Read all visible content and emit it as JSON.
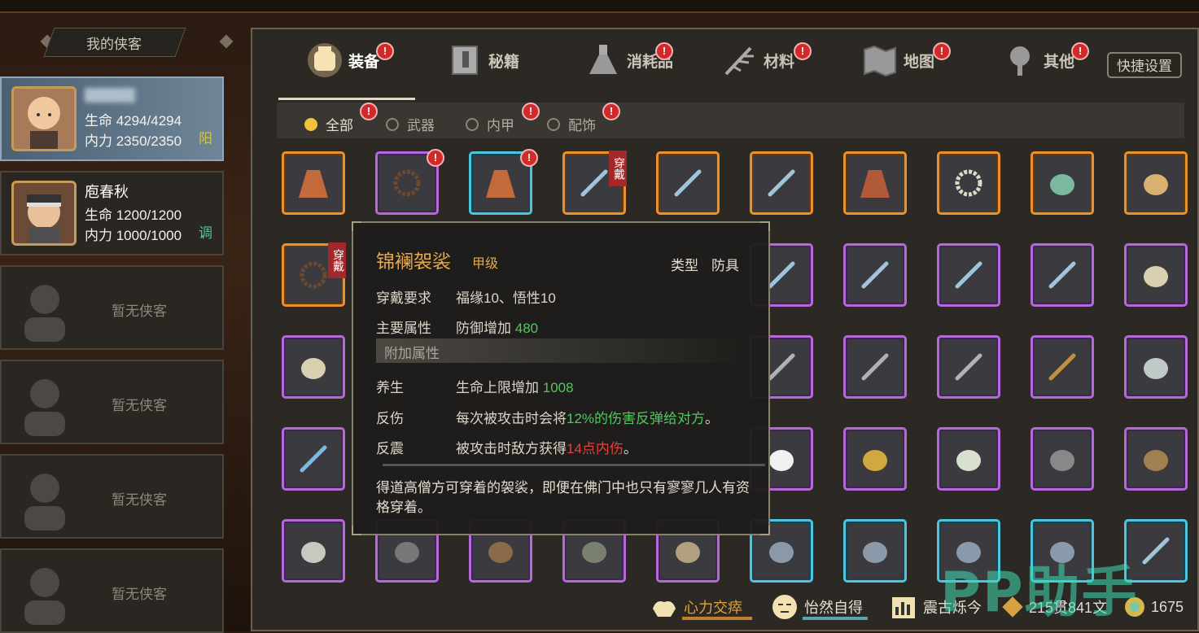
{
  "roster": {
    "header": "我的侠客",
    "members": [
      {
        "name": "",
        "hp": "生命 4294/4294",
        "mp": "内力 2350/2350",
        "tag": "阳",
        "tag_color": "#d6c33a"
      },
      {
        "name": "庖春秋",
        "hp": "生命 1200/1200",
        "mp": "内力 1000/1000",
        "tag": "调",
        "tag_color": "#4ec89a"
      }
    ],
    "empty_label": "暂无侠客"
  },
  "tabs": [
    {
      "label": "装备",
      "icon": "equipment-bag-icon",
      "alert": true
    },
    {
      "label": "秘籍",
      "icon": "book-icon",
      "alert": false
    },
    {
      "label": "消耗品",
      "icon": "potion-flask-icon",
      "alert": true
    },
    {
      "label": "材料",
      "icon": "herb-material-icon",
      "alert": true
    },
    {
      "label": "地图",
      "icon": "map-icon",
      "alert": true
    },
    {
      "label": "其他",
      "icon": "other-bag-icon",
      "alert": true
    }
  ],
  "quick_settings": "快捷设置",
  "alert_mark": "!",
  "filters": [
    {
      "label": "全部",
      "on": true,
      "alert": true
    },
    {
      "label": "武器",
      "on": false,
      "alert": false
    },
    {
      "label": "内甲",
      "on": false,
      "alert": true
    },
    {
      "label": "配饰",
      "on": false,
      "alert": true
    }
  ],
  "worn_badge": "穿戴",
  "items": [
    {
      "r": 0,
      "c": 0,
      "rarity": "o",
      "icon": "robe-icon",
      "worn": false,
      "alert": false
    },
    {
      "r": 0,
      "c": 1,
      "rarity": "p",
      "icon": "prayer-beads-icon",
      "worn": false,
      "alert": true
    },
    {
      "r": 0,
      "c": 2,
      "rarity": "c",
      "icon": "robe-icon",
      "worn": false,
      "alert": true
    },
    {
      "r": 0,
      "c": 3,
      "rarity": "o",
      "icon": "sword-icon",
      "worn": true,
      "alert": false
    },
    {
      "r": 0,
      "c": 4,
      "rarity": "o",
      "icon": "sword-icon",
      "worn": false,
      "alert": false
    },
    {
      "r": 0,
      "c": 5,
      "rarity": "o",
      "icon": "sword-icon",
      "worn": false,
      "alert": false
    },
    {
      "r": 0,
      "c": 6,
      "rarity": "o",
      "icon": "cloak-icon",
      "worn": false,
      "alert": false
    },
    {
      "r": 0,
      "c": 7,
      "rarity": "o",
      "icon": "jade-pendant-icon",
      "worn": false,
      "alert": false
    },
    {
      "r": 0,
      "c": 8,
      "rarity": "o",
      "icon": "jade-toad-icon",
      "worn": false,
      "alert": false
    },
    {
      "r": 0,
      "c": 9,
      "rarity": "o",
      "icon": "pearl-box-icon",
      "worn": false,
      "alert": false
    },
    {
      "r": 1,
      "c": 0,
      "rarity": "o",
      "icon": "prayer-beads-icon",
      "worn": true,
      "alert": false
    },
    {
      "r": 1,
      "c": 5,
      "rarity": "p",
      "icon": "sword-icon",
      "worn": false,
      "alert": false
    },
    {
      "r": 1,
      "c": 6,
      "rarity": "p",
      "icon": "sword-icon",
      "worn": false,
      "alert": false
    },
    {
      "r": 1,
      "c": 7,
      "rarity": "p",
      "icon": "sword-icon",
      "worn": false,
      "alert": false
    },
    {
      "r": 1,
      "c": 8,
      "rarity": "p",
      "icon": "sword-icon",
      "worn": false,
      "alert": false
    },
    {
      "r": 1,
      "c": 9,
      "rarity": "p",
      "icon": "scimitar-icon",
      "worn": false,
      "alert": false
    },
    {
      "r": 2,
      "c": 0,
      "rarity": "p",
      "icon": "scimitar-icon",
      "worn": false,
      "alert": false
    },
    {
      "r": 2,
      "c": 5,
      "rarity": "p",
      "icon": "spear-icon",
      "worn": false,
      "alert": false
    },
    {
      "r": 2,
      "c": 6,
      "rarity": "p",
      "icon": "spear-icon",
      "worn": false,
      "alert": false
    },
    {
      "r": 2,
      "c": 7,
      "rarity": "p",
      "icon": "spear-icon",
      "worn": false,
      "alert": false
    },
    {
      "r": 2,
      "c": 8,
      "rarity": "p",
      "icon": "staff-icon",
      "worn": false,
      "alert": false
    },
    {
      "r": 2,
      "c": 9,
      "rarity": "p",
      "icon": "fan-icon",
      "worn": false,
      "alert": false
    },
    {
      "r": 3,
      "c": 0,
      "rarity": "p",
      "icon": "double-spear-icon",
      "worn": false,
      "alert": false
    },
    {
      "r": 3,
      "c": 5,
      "rarity": "p",
      "icon": "flower-icon",
      "worn": false,
      "alert": false
    },
    {
      "r": 3,
      "c": 6,
      "rarity": "p",
      "icon": "gold-nugget-icon",
      "worn": false,
      "alert": false
    },
    {
      "r": 3,
      "c": 7,
      "rarity": "p",
      "icon": "orb-icon",
      "worn": false,
      "alert": false
    },
    {
      "r": 3,
      "c": 8,
      "rarity": "p",
      "icon": "sickle-icon",
      "worn": false,
      "alert": false
    },
    {
      "r": 3,
      "c": 9,
      "rarity": "p",
      "icon": "armor-plate-icon",
      "worn": false,
      "alert": false
    },
    {
      "r": 4,
      "c": 0,
      "rarity": "p",
      "icon": "stone-icon",
      "worn": false,
      "alert": false
    },
    {
      "r": 4,
      "c": 1,
      "rarity": "p",
      "icon": "bowl-icon",
      "worn": false,
      "alert": false
    },
    {
      "r": 4,
      "c": 2,
      "rarity": "p",
      "icon": "jar-icon",
      "worn": false,
      "alert": false
    },
    {
      "r": 4,
      "c": 3,
      "rarity": "p",
      "icon": "bar-icon",
      "worn": false,
      "alert": false
    },
    {
      "r": 4,
      "c": 4,
      "rarity": "p",
      "icon": "pouch-icon",
      "worn": false,
      "alert": false
    },
    {
      "r": 4,
      "c": 5,
      "rarity": "c",
      "icon": "gauntlet-icon",
      "worn": false,
      "alert": false
    },
    {
      "r": 4,
      "c": 6,
      "rarity": "c",
      "icon": "gauntlet-icon",
      "worn": false,
      "alert": false
    },
    {
      "r": 4,
      "c": 7,
      "rarity": "c",
      "icon": "gauntlet-icon",
      "worn": false,
      "alert": false
    },
    {
      "r": 4,
      "c": 8,
      "rarity": "c",
      "icon": "gauntlet-icon",
      "worn": false,
      "alert": false
    },
    {
      "r": 4,
      "c": 9,
      "rarity": "c",
      "icon": "sword-icon",
      "worn": false,
      "alert": false
    }
  ],
  "tooltip": {
    "title": "锦襕袈裟",
    "grade": "甲级",
    "type_label": "类型",
    "type_value": "防具",
    "rows": [
      {
        "k": "穿戴要求",
        "v": "福缘10、悟性10",
        "hl": "",
        "tail": ""
      },
      {
        "k": "主要属性",
        "v": "防御增加 ",
        "hl": "480",
        "tail": "",
        "hlc": "g"
      }
    ],
    "extra_header": "附加属性",
    "extras": [
      {
        "k": "养生",
        "v": "生命上限增加 ",
        "hl": "1008",
        "tail": "",
        "hlc": "g"
      },
      {
        "k": "反伤",
        "v": "每次被攻击时会将",
        "hl": "12%的伤害反弹给对方",
        "tail": "。",
        "hlc": "g"
      },
      {
        "k": "反震",
        "v": "被攻击时敌方获得",
        "hl": "14点内伤",
        "tail": "。",
        "hlc": "r"
      }
    ],
    "description": "得道高僧方可穿着的袈裟，即便在佛门中也只有寥寥几人有资格穿着。"
  },
  "bottom": {
    "skills": [
      {
        "label": "心力交瘁",
        "icon": "muscle-icon",
        "color": "#e2a23a"
      },
      {
        "label": "怡然自得",
        "icon": "calm-face-icon",
        "color": "#e6e0d2"
      },
      {
        "label": "震古烁今",
        "icon": "scroll-rank-icon",
        "color": "#e6e0d2"
      }
    ],
    "money": "215贯841文",
    "gems": "1675"
  },
  "watermark": "PP助手"
}
